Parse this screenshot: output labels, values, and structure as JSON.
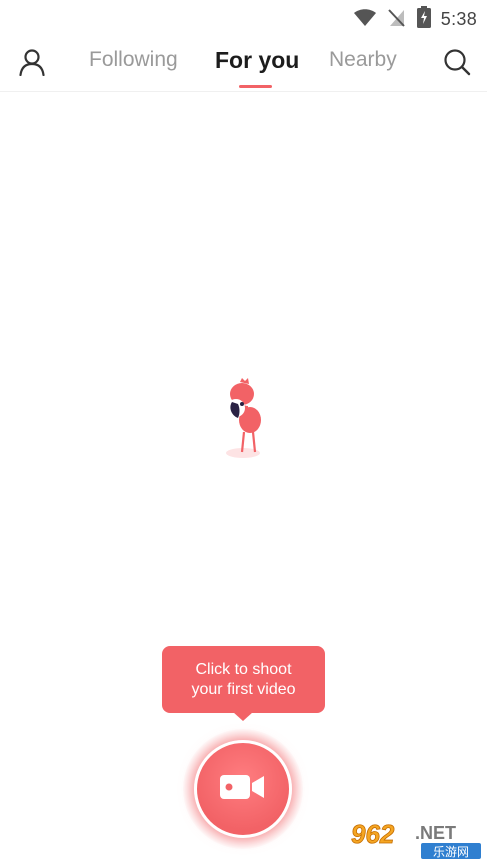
{
  "status_bar": {
    "time": "5:38",
    "icons": [
      "wifi-icon",
      "no-signal-icon",
      "battery-charging-icon"
    ]
  },
  "nav": {
    "profile_icon": "person-icon",
    "tabs": [
      {
        "label": "Following",
        "active": false
      },
      {
        "label": "For you",
        "active": true
      },
      {
        "label": "Nearby",
        "active": false
      }
    ],
    "search_icon": "search-icon"
  },
  "empty_state": {
    "illustration": "flamingo-mascot"
  },
  "tooltip": {
    "line1": "Click to shoot",
    "line2": "your first video"
  },
  "record_button": {
    "icon": "video-camera-icon"
  },
  "watermark": {
    "number": "962",
    "suffix": ".NET",
    "subtitle": "乐游网"
  },
  "colors": {
    "accent": "#f26266",
    "text_primary": "#1c1c1c",
    "text_secondary": "#9a9a9a",
    "status_icons": "#555555"
  }
}
